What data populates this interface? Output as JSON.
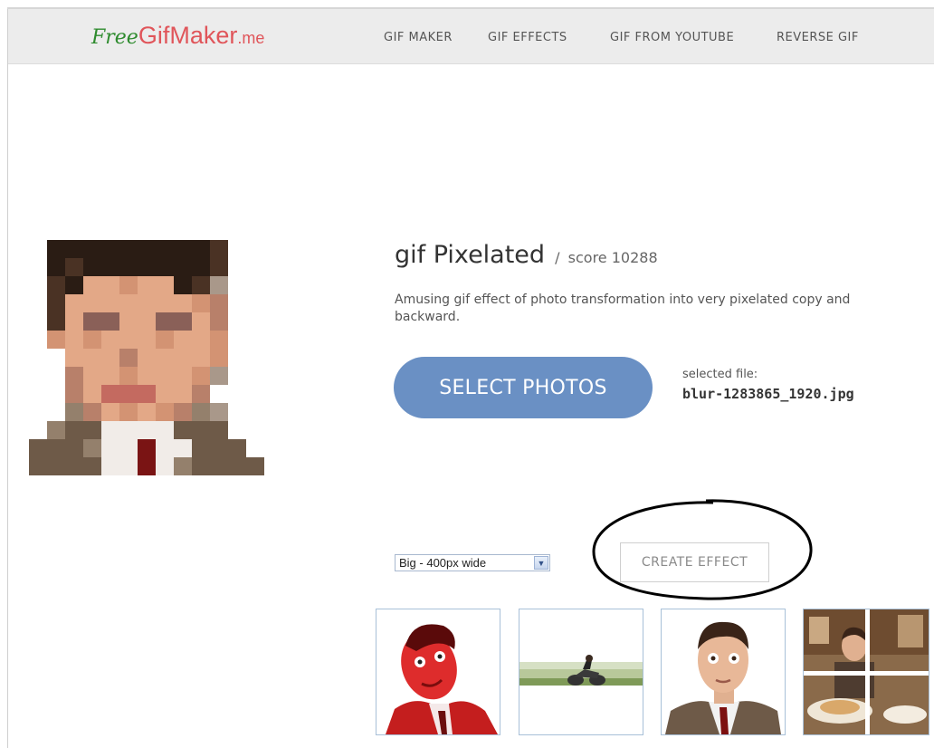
{
  "logo": {
    "free": "Free",
    "gif": "GifMaker",
    "me": ".me"
  },
  "nav": {
    "items": [
      "GIF MAKER",
      "GIF EFFECTS",
      "GIF FROM YOUTUBE",
      "REVERSE GIF"
    ]
  },
  "effect": {
    "title": "gif Pixelated",
    "separator": "/",
    "score": "score 10288",
    "description": "Amusing gif effect of photo transformation into very pixelated copy and backward."
  },
  "upload": {
    "button_label": "SELECT PHOTOS",
    "selected_label": "selected file:",
    "selected_file": "blur-1283865_1920.jpg"
  },
  "size_select": {
    "selected": "Big - 400px wide"
  },
  "create_button": {
    "label": "CREATE EFFECT"
  },
  "colors": {
    "nav_bg": "#ececec",
    "logo_free": "#2e8b2e",
    "logo_main": "#e0555a",
    "primary_button": "#6a90c4",
    "thumb_border": "#a8c0d8",
    "annotation": "#000000"
  },
  "thumbnails": [
    "red-portrait",
    "motorbike-strip",
    "face-portrait",
    "restaurant-collage"
  ]
}
